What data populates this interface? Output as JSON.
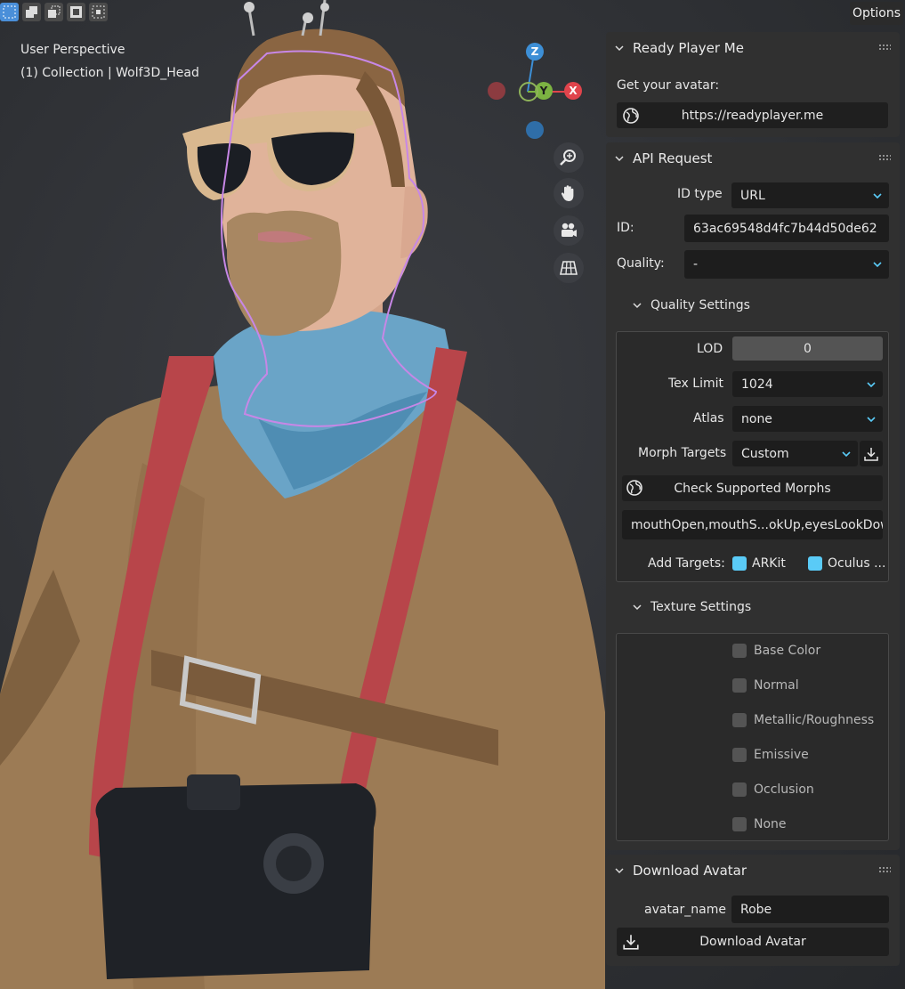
{
  "viewport": {
    "view_name": "User Perspective",
    "collection": "(1) Collection | Wolf3D_Head",
    "options_label": "Options",
    "gizmo": {
      "z": "Z",
      "y": "Y",
      "x": "X"
    },
    "nav_icons": [
      "zoom-icon",
      "hand-icon",
      "camera-icon",
      "grid-icon"
    ]
  },
  "panels": {
    "rpm": {
      "title": "Ready Player Me",
      "get_avatar_label": "Get your avatar:",
      "link_label": "https://readyplayer.me"
    },
    "api": {
      "title": "API Request",
      "id_type_label": "ID type",
      "id_type_value": "URL",
      "id_label": "ID:",
      "id_value": "63ac69548d4fc7b44d50de62",
      "quality_label": "Quality:",
      "quality_value": "-",
      "quality_settings": {
        "title": "Quality Settings",
        "lod_label": "LOD",
        "lod_value": "0",
        "tex_limit_label": "Tex Limit",
        "tex_limit_value": "1024",
        "atlas_label": "Atlas",
        "atlas_value": "none",
        "morph_targets_label": "Morph Targets",
        "morph_targets_value": "Custom",
        "check_morphs_label": "Check Supported Morphs",
        "morphs_text": "mouthOpen,mouthS...okUp,eyesLookDown",
        "add_targets_label": "Add Targets:",
        "arkit_label": "ARKit",
        "oculus_label": "Oculus ..."
      },
      "texture_settings": {
        "title": "Texture Settings",
        "items": [
          "Base Color",
          "Normal",
          "Metallic/Roughness",
          "Emissive",
          "Occlusion",
          "None"
        ]
      }
    },
    "download": {
      "title": "Download Avatar",
      "name_label": "avatar_name",
      "name_value": "Robe",
      "button_label": "Download Avatar"
    }
  },
  "colors": {
    "accent": "#5acbf7",
    "x_axis": "#e0444c",
    "y_axis": "#7cb342",
    "z_axis": "#3d8fd6"
  }
}
